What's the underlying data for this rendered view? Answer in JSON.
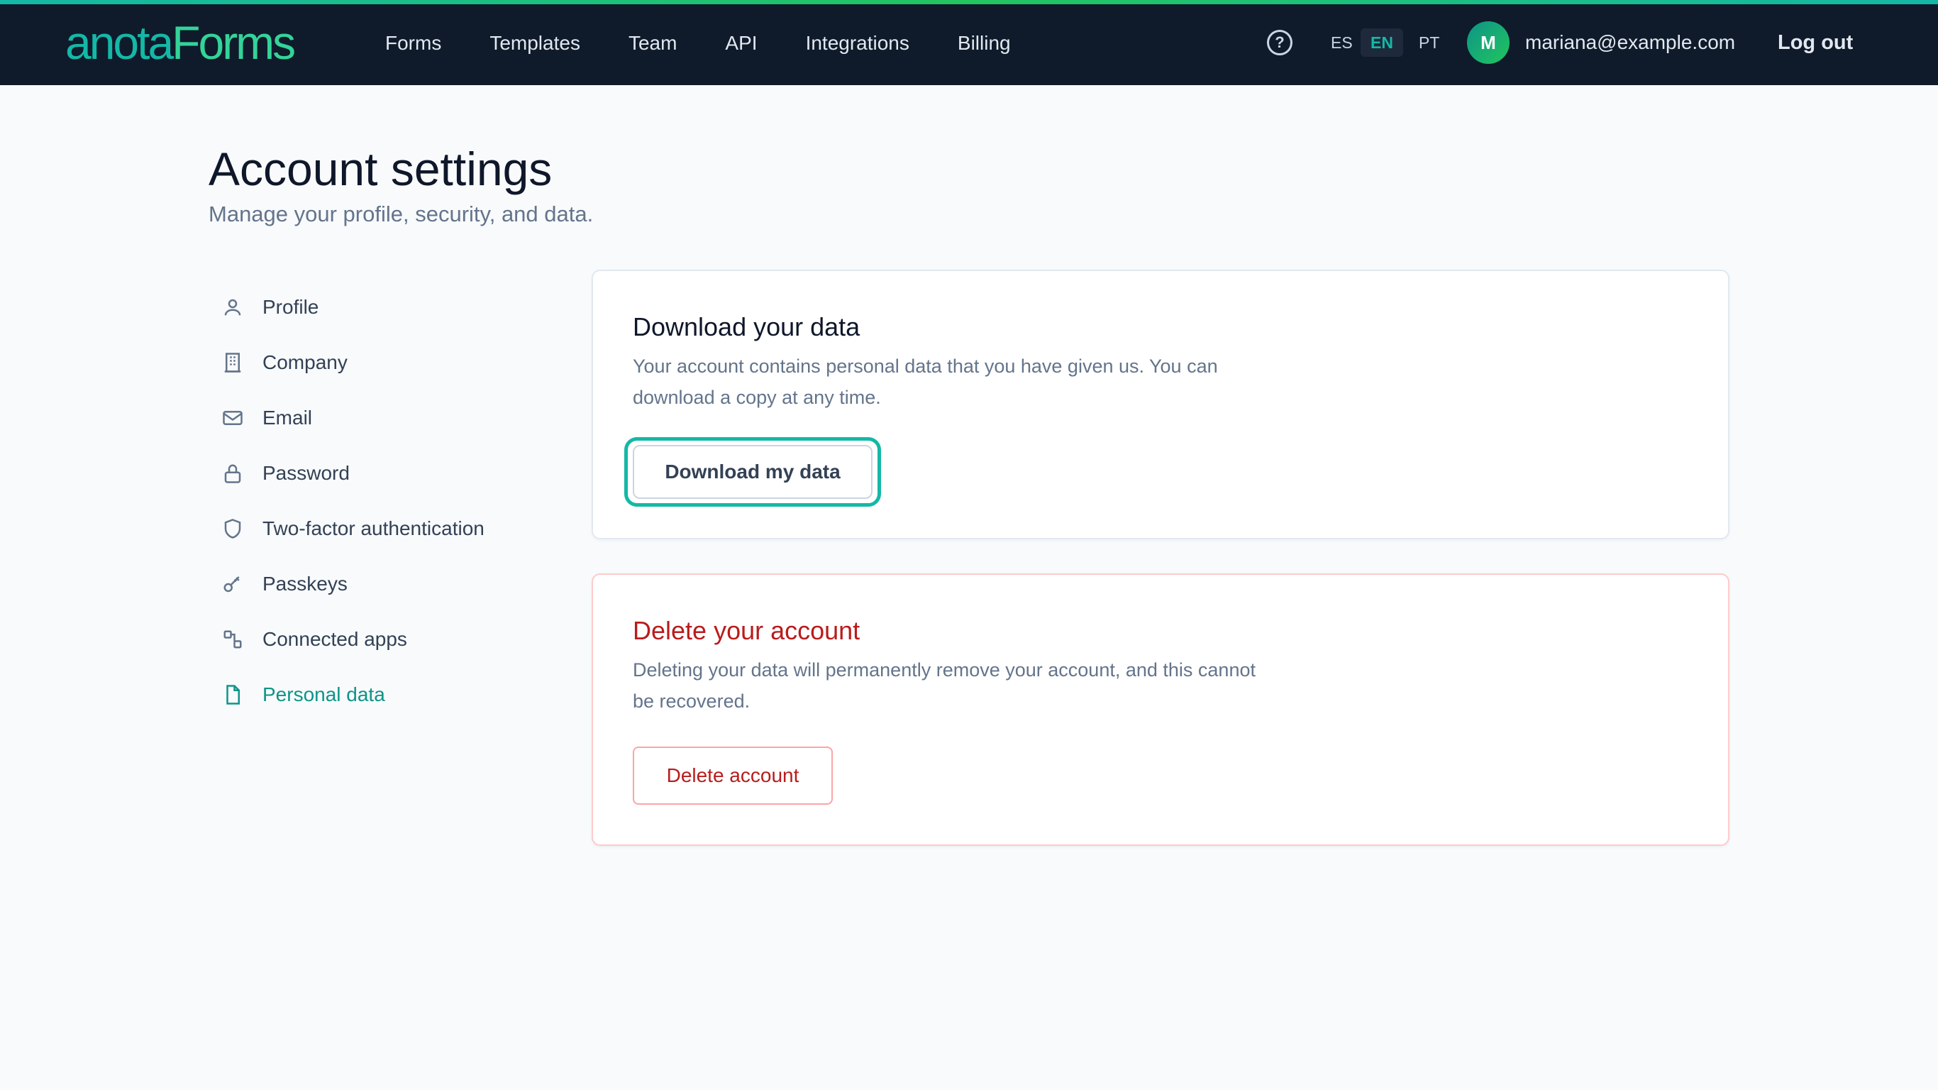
{
  "brand": {
    "part1": "anota",
    "part2": "Forms"
  },
  "nav": [
    "Forms",
    "Templates",
    "Team",
    "API",
    "Integrations",
    "Billing"
  ],
  "header": {
    "help_glyph": "?",
    "languages": [
      {
        "code": "ES",
        "active": false
      },
      {
        "code": "EN",
        "active": true
      },
      {
        "code": "PT",
        "active": false
      }
    ],
    "avatar_initial": "M",
    "user_email": "mariana@example.com",
    "logout_label": "Log out"
  },
  "page": {
    "title": "Account settings",
    "subtitle": "Manage your profile, security, and data."
  },
  "sidebar": {
    "items": [
      {
        "label": "Profile",
        "icon": "user-icon",
        "active": false
      },
      {
        "label": "Company",
        "icon": "building-icon",
        "active": false
      },
      {
        "label": "Email",
        "icon": "mail-icon",
        "active": false
      },
      {
        "label": "Password",
        "icon": "lock-icon",
        "active": false
      },
      {
        "label": "Two-factor authentication",
        "icon": "shield-icon",
        "active": false
      },
      {
        "label": "Passkeys",
        "icon": "key-icon",
        "active": false
      },
      {
        "label": "Connected apps",
        "icon": "apps-icon",
        "active": false
      },
      {
        "label": "Personal data",
        "icon": "file-icon",
        "active": true
      }
    ]
  },
  "download_card": {
    "title": "Download your data",
    "description": "Your account contains personal data that you have given us. You can download a copy at any time.",
    "button_label": "Download my data"
  },
  "delete_card": {
    "title": "Delete your account",
    "description": "Deleting your data will permanently remove your account, and this cannot be recovered.",
    "button_label": "Delete account"
  },
  "colors": {
    "topbar": "#0f1b2b",
    "accent": "#14b8a6",
    "danger": "#b91c1c"
  }
}
